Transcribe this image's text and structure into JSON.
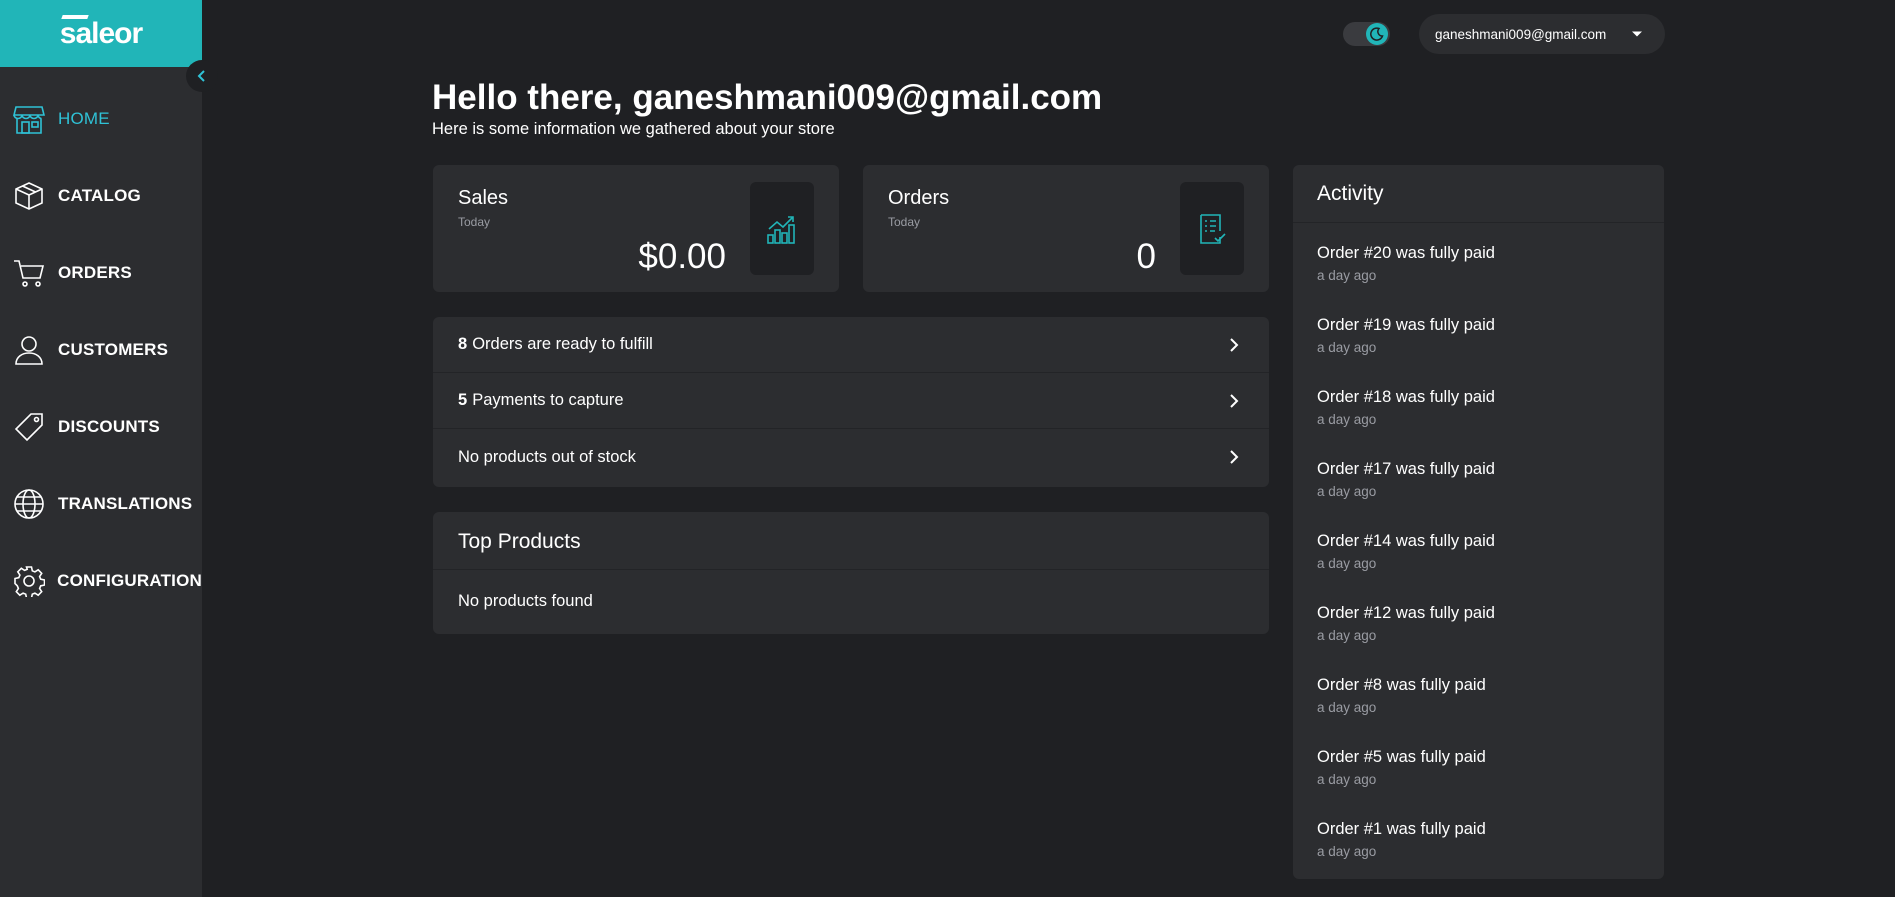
{
  "brand": {
    "name": "saleor"
  },
  "sidebar": {
    "items": [
      {
        "label": "HOME",
        "icon": "storefront-icon",
        "active": true
      },
      {
        "label": "CATALOG",
        "icon": "box-icon"
      },
      {
        "label": "ORDERS",
        "icon": "cart-icon"
      },
      {
        "label": "CUSTOMERS",
        "icon": "user-icon"
      },
      {
        "label": "DISCOUNTS",
        "icon": "tag-icon"
      },
      {
        "label": "TRANSLATIONS",
        "icon": "globe-icon"
      },
      {
        "label": "CONFIGURATION",
        "icon": "gear-icon"
      }
    ]
  },
  "header": {
    "user_email": "ganeshmani009@gmail.com",
    "theme_icon": "moon-icon"
  },
  "welcome": {
    "title": "Hello there, ganeshmani009@gmail.com",
    "subtitle": "Here is some information we gathered about your store"
  },
  "stats": {
    "sales": {
      "title": "Sales",
      "period": "Today",
      "value": "$0.00",
      "icon": "chart-icon"
    },
    "orders": {
      "title": "Orders",
      "period": "Today",
      "value": "0",
      "icon": "checklist-icon"
    }
  },
  "todos": [
    {
      "count": "8",
      "text": "Orders are ready to fulfill"
    },
    {
      "count": "5",
      "text": "Payments to capture"
    },
    {
      "count": "",
      "text": "No products out of stock"
    }
  ],
  "top_products": {
    "title": "Top Products",
    "empty": "No products found"
  },
  "activity": {
    "title": "Activity",
    "items": [
      {
        "text": "Order #20 was fully paid",
        "time": "a day ago"
      },
      {
        "text": "Order #19 was fully paid",
        "time": "a day ago"
      },
      {
        "text": "Order #18 was fully paid",
        "time": "a day ago"
      },
      {
        "text": "Order #17 was fully paid",
        "time": "a day ago"
      },
      {
        "text": "Order #14 was fully paid",
        "time": "a day ago"
      },
      {
        "text": "Order #12 was fully paid",
        "time": "a day ago"
      },
      {
        "text": "Order #8 was fully paid",
        "time": "a day ago"
      },
      {
        "text": "Order #5 was fully paid",
        "time": "a day ago"
      },
      {
        "text": "Order #1 was fully paid",
        "time": "a day ago"
      }
    ]
  },
  "colors": {
    "accent": "#21b5b8",
    "active_nav": "#2fc2d6",
    "background": "#1f2023",
    "card": "#2c2d30"
  }
}
